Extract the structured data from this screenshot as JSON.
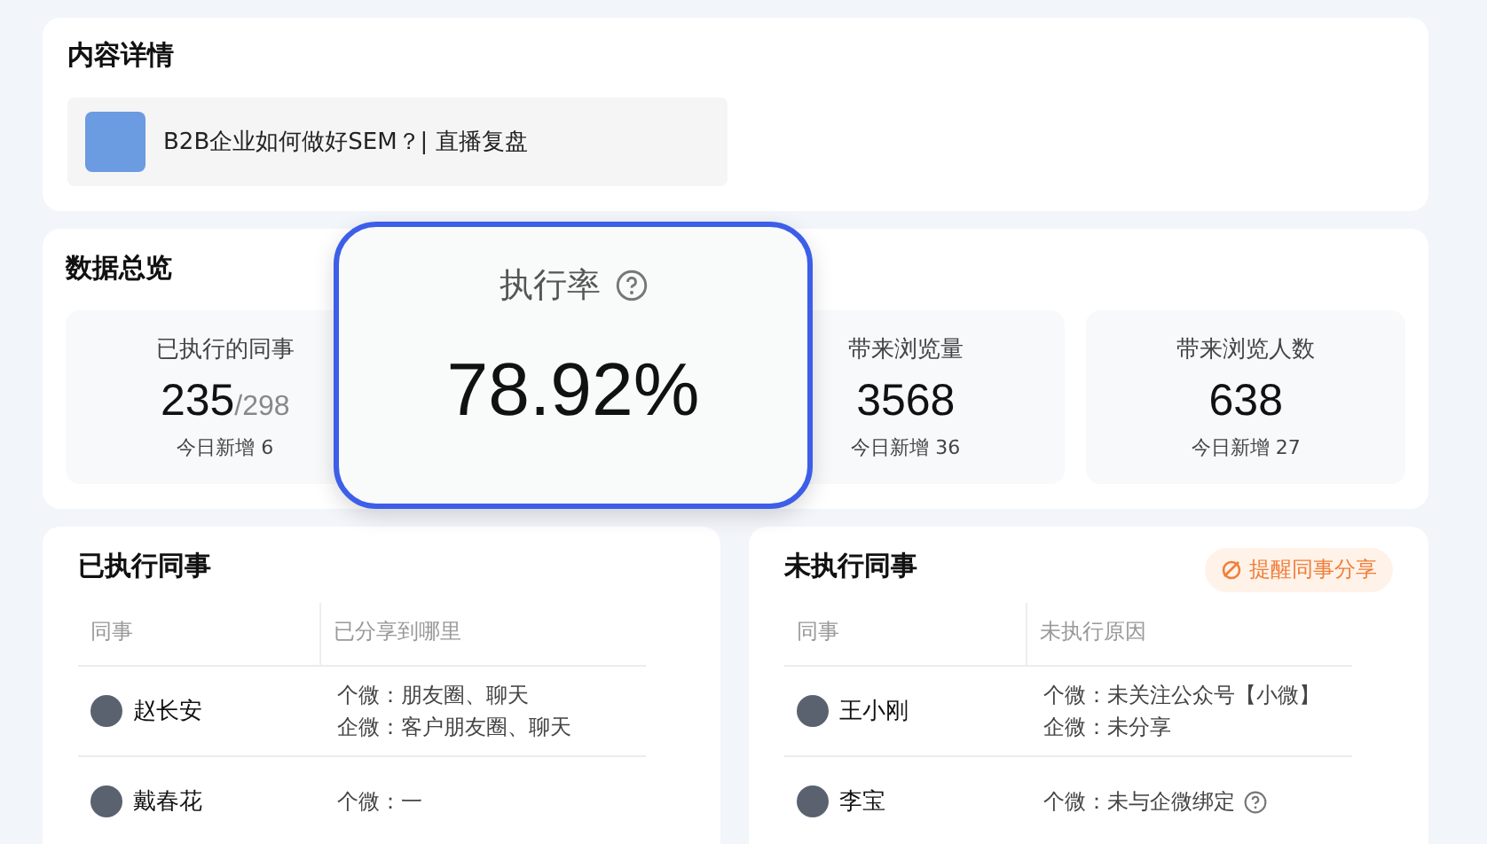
{
  "content_detail": {
    "title": "内容详情",
    "item_title": "B2B企业如何做好SEM？| 直播复盘"
  },
  "overview": {
    "title": "数据总览",
    "stats": [
      {
        "label": "已执行的同事",
        "value": "235",
        "total": "/298",
        "today": "今日新增  6"
      },
      {
        "label": "带来浏览量",
        "value": "3568",
        "today": "今日新增  36"
      },
      {
        "label": "带来浏览人数",
        "value": "638",
        "today": "今日新增  27"
      }
    ],
    "popup": {
      "label": "执行率",
      "value": "78.92%"
    }
  },
  "executed": {
    "title": "已执行同事",
    "columns": [
      "同事",
      "已分享到哪里"
    ],
    "rows": [
      {
        "name": "赵长安",
        "lines": [
          {
            "text": "个微：朋友圈、聊天",
            "help": false
          },
          {
            "text": "企微：客户朋友圈、聊天",
            "help": false
          }
        ]
      },
      {
        "name": "戴春花",
        "lines": [
          {
            "text": "个微：一",
            "help": false
          }
        ]
      }
    ]
  },
  "not_executed": {
    "title": "未执行同事",
    "action": "提醒同事分享",
    "columns": [
      "同事",
      "未执行原因"
    ],
    "rows": [
      {
        "name": "王小刚",
        "lines": [
          {
            "text": "个微：未关注公众号【小微】",
            "help": false
          },
          {
            "text": "企微：未分享",
            "help": false
          }
        ]
      },
      {
        "name": "李宝",
        "lines": [
          {
            "text": "个微：未与企微绑定",
            "help": true
          }
        ]
      }
    ]
  }
}
